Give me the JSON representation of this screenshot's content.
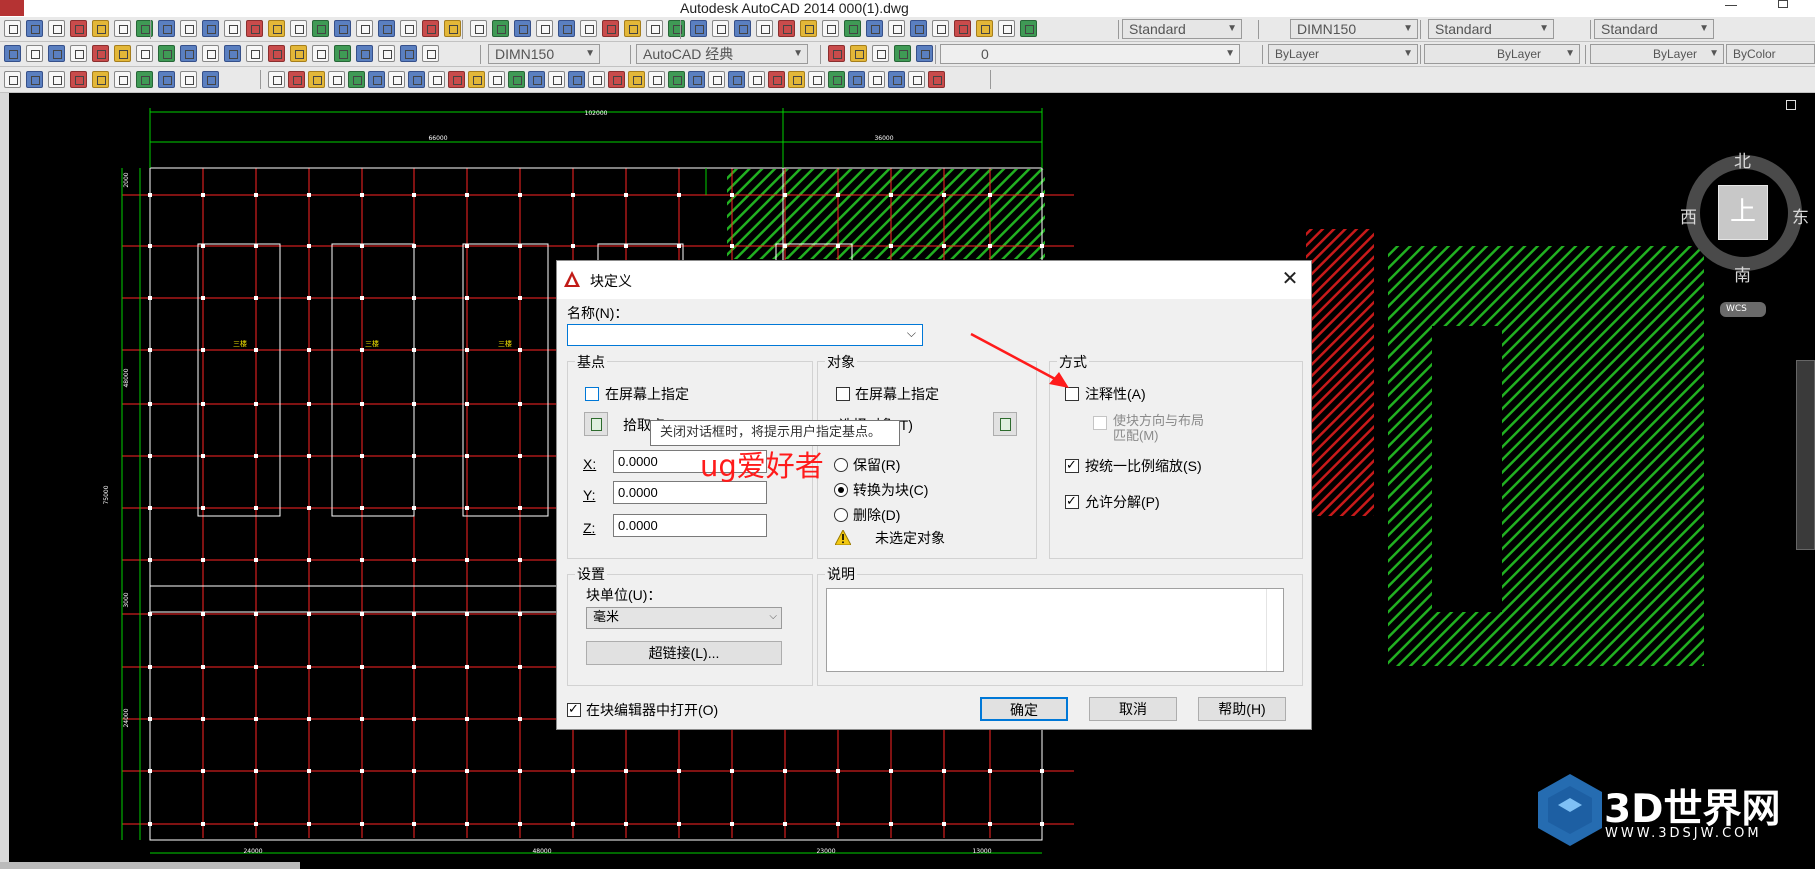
{
  "window": {
    "title": "Autodesk AutoCAD 2014     000(1).dwg"
  },
  "toolbar": {
    "text_style": "Standard",
    "dim_style": "DIMN150",
    "table_style": "Standard",
    "multileader_style": "Standard",
    "dim_style_2": "DIMN150",
    "workspace": "AutoCAD 经典",
    "layer": "0",
    "color": "ByLayer",
    "linetype": "ByLayer",
    "lineweight": "ByLayer",
    "plotstyle": "ByColor"
  },
  "drawing": {
    "dims_top": [
      "102000",
      "66000",
      "36000"
    ],
    "dims_bottom": [
      "24000",
      "48000",
      "23000",
      "13000"
    ],
    "dims_left": [
      "2000",
      "48000",
      "75000",
      "3000",
      "24000"
    ],
    "room_labels": [
      "三楼",
      "三楼",
      "三楼"
    ],
    "colors": {
      "grid": "#ff2424",
      "frame": "#ffffff",
      "dim": "#00d000",
      "hatch_green": "#21b021",
      "hatch_red": "#c81a1a",
      "label": "#f0e000"
    }
  },
  "viewcube": {
    "north": "北",
    "south": "南",
    "east": "东",
    "west": "西",
    "top": "上",
    "wcs": "WCS"
  },
  "dialog": {
    "title": "块定义",
    "name_label": "名称(N)：",
    "name_value": "",
    "base_point": {
      "group": "基点",
      "specify_on_screen": "在屏幕上指定",
      "pick_point": "拾取点",
      "x_label": "X:",
      "x_value": "0.0000",
      "y_label": "Y:",
      "y_value": "0.0000",
      "z_label": "Z:",
      "z_value": "0.0000"
    },
    "objects": {
      "group": "对象",
      "specify_on_screen": "在屏幕上指定",
      "select_objects": "选择对象(T)",
      "retain": "保留(R)",
      "convert": "转换为块(C)",
      "delete": "删除(D)",
      "warning": "未选定对象"
    },
    "behavior": {
      "group": "方式",
      "annotative": "注释性(A)",
      "match_orientation_1": "使块方向与布局",
      "match_orientation_2": "匹配(M)",
      "scale_uniformly": "按统一比例缩放(S)",
      "allow_explode": "允许分解(P)"
    },
    "settings": {
      "group": "设置",
      "unit_label": "块单位(U)：",
      "unit_value": "毫米",
      "hyperlink": "超链接(L)..."
    },
    "description": {
      "group": "说明"
    },
    "open_in_editor": "在块编辑器中打开(O)",
    "ok": "确定",
    "cancel": "取消",
    "help": "帮助(H)"
  },
  "tooltip": "关闭对话框时，将提示用户指定基点。",
  "watermark": "ug爱好者",
  "logo": {
    "name": "3D世界网",
    "url": "WWW.3DSJW.COM"
  }
}
